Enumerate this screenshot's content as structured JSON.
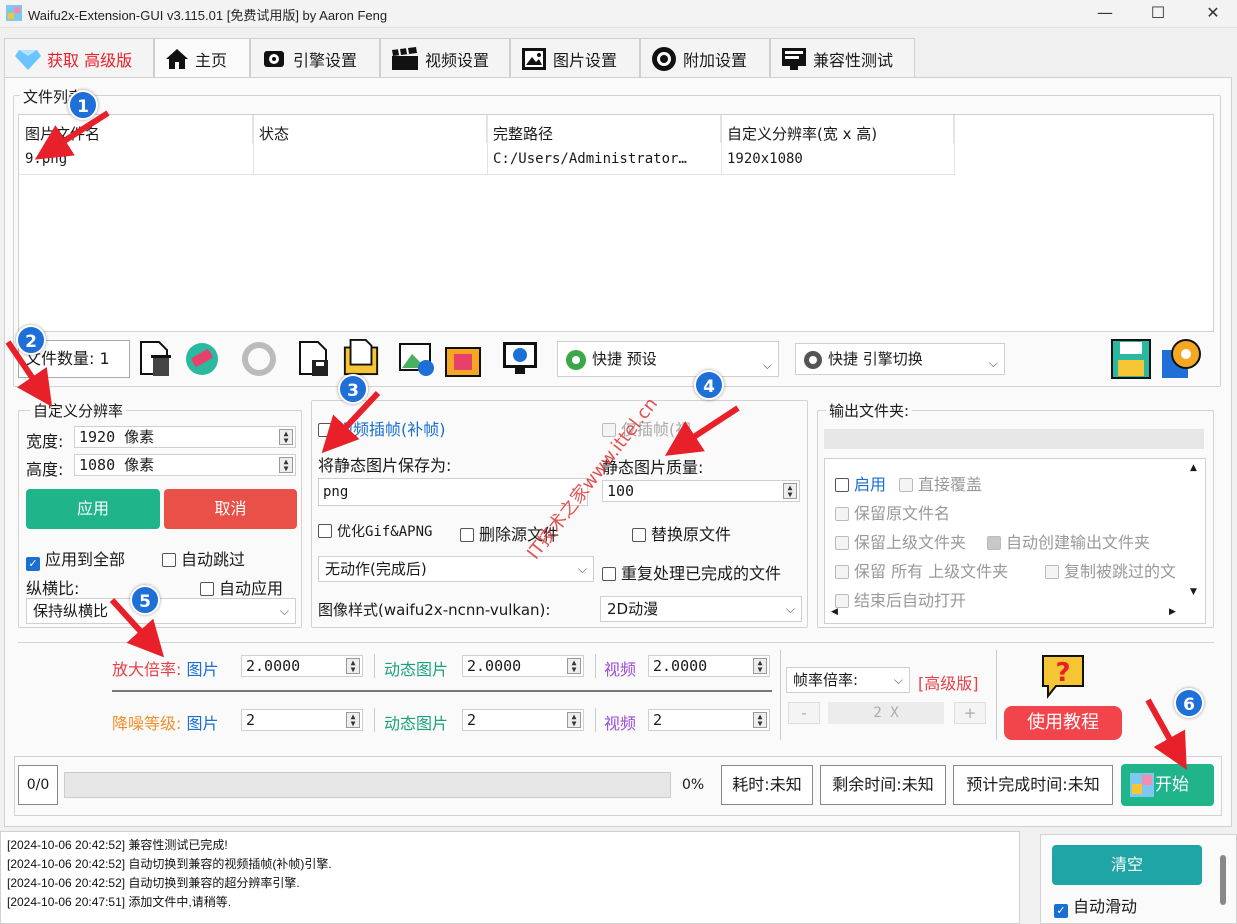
{
  "window": {
    "title": "Waifu2x-Extension-GUI v3.115.01 [免费试用版] by Aaron Feng",
    "minimize": "—",
    "maximize": "☐",
    "close": "✕"
  },
  "tabs": [
    {
      "label": "获取 高级版",
      "icon": "diamond-icon"
    },
    {
      "label": "主页",
      "icon": "home-icon"
    },
    {
      "label": "引擎设置",
      "icon": "engine-icon"
    },
    {
      "label": "视频设置",
      "icon": "clapperboard-icon"
    },
    {
      "label": "图片设置",
      "icon": "image-icon"
    },
    {
      "label": "附加设置",
      "icon": "settings-circle-icon"
    },
    {
      "label": "兼容性测试",
      "icon": "test-icon"
    }
  ],
  "file_list": {
    "group_label": "文件列表",
    "columns": [
      "图片文件名",
      "状态",
      "完整路径",
      "自定义分辨率(宽 x 高)"
    ],
    "rows": [
      {
        "name": "9.png",
        "status": "",
        "path": "C:/Users/Administrator…",
        "resolution": "1920x1080"
      }
    ]
  },
  "toolbar": {
    "file_count": "文件数量: 1",
    "preset_label": "快捷 预设",
    "engine_switch_label": "快捷 引擎切换"
  },
  "custom_res": {
    "group_label": "自定义分辨率",
    "width_label": "宽度:",
    "width_value": "1920 像素",
    "height_label": "高度:",
    "height_value": "1080 像素",
    "apply": "应用",
    "cancel": "取消",
    "apply_all": "应用到全部",
    "auto_skip": "自动跳过",
    "aspect_label": "纵横比:",
    "auto_apply": "自动应用",
    "aspect_value": "保持纵横比"
  },
  "middle": {
    "video_interp": "视频插帧(补帧)",
    "interp_only": "仅插帧(视",
    "save_as_label": "将静态图片保存为:",
    "save_as_value": "png",
    "quality_label": "静态图片质量:",
    "quality_value": "100",
    "optimize_gif": "优化Gif&APNG",
    "delete_source": "删除源文件",
    "replace_source": "替换原文件",
    "after_action": "无动作(完成后)",
    "reprocess": "重复处理已完成的文件",
    "style_label": "图像样式(waifu2x-ncnn-vulkan):",
    "style_value": "2D动漫"
  },
  "output": {
    "group_label": "输出文件夹:",
    "enable": "启用",
    "overwrite": "直接覆盖",
    "keep_name": "保留原文件名",
    "keep_parent": "保留上级文件夹",
    "auto_create": "自动创建输出文件夹",
    "keep_all": "保留 所有 上级文件夹",
    "copy_skipped": "复制被跳过的文",
    "open_after": "结束后自动打开"
  },
  "scale": {
    "scale_label": "放大倍率:",
    "denoise_label": "降噪等级:",
    "image": "图片",
    "gif": "动态图片",
    "video": "视频",
    "scale_image": "2.0000",
    "scale_gif": "2.0000",
    "scale_video": "2.0000",
    "denoise_image": "2",
    "denoise_gif": "2",
    "denoise_video": "2",
    "fps_label": "帧率倍率:",
    "premium": "[高级版]",
    "fps_minus": "-",
    "fps_value": "2 X",
    "fps_plus": "+",
    "tutorial": "使用教程"
  },
  "progress": {
    "counter": "0/0",
    "percent": "0%",
    "percent_value": 0,
    "elapsed": "耗时:未知",
    "remaining": "剩余时间:未知",
    "eta": "预计完成时间:未知",
    "start": "开始"
  },
  "log": {
    "lines": [
      "[2024-10-06 20:42:52] 兼容性测试已完成!",
      "[2024-10-06 20:42:52] 自动切换到兼容的视频插帧(补帧)引擎.",
      "[2024-10-06 20:42:52] 自动切换到兼容的超分辨率引擎.",
      "[2024-10-06 20:47:51] 添加文件中,请稍等."
    ]
  },
  "side": {
    "clear": "清空",
    "auto_scroll": "自动滑动"
  },
  "badges": [
    "1",
    "2",
    "3",
    "4",
    "5",
    "6"
  ],
  "watermark": "IT技术之家www.ittel.cn",
  "colors": {
    "accent_blue": "#1e6fd8",
    "green": "#1fb48a",
    "red": "#e85048",
    "arrow_red": "#e8202a"
  }
}
